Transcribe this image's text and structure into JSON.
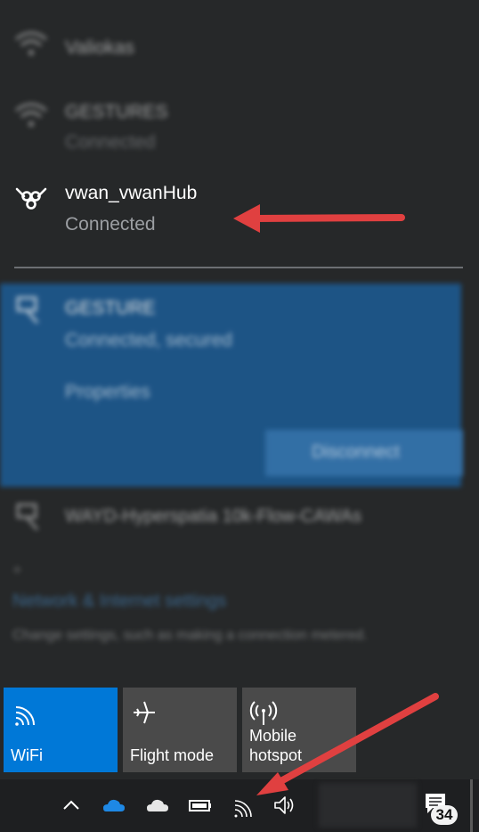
{
  "flyout": {
    "networks_above": [
      {
        "name": "Valiokas",
        "icon": "wifi-icon"
      },
      {
        "name": "GESTURES",
        "status": "Connected",
        "icon": "wifi-icon"
      }
    ],
    "vpn": {
      "name": "vwan_vwanHub",
      "status": "Connected",
      "icon": "vpn-icon"
    },
    "selected_network": {
      "name": "GESTURE",
      "status": "Connected, secured",
      "properties_label": "Properties",
      "disconnect_label": "Disconnect",
      "icon": "ethernet-icon"
    },
    "other_network": {
      "name": "WAYD-Hyperspatia 10k-Flow-CAWAs",
      "icon": "ethernet-icon"
    },
    "settings": {
      "link": "Network & Internet settings",
      "description": "Change settings, such as making a connection metered."
    }
  },
  "quick_actions": [
    {
      "label": "WiFi",
      "icon": "wifi-icon",
      "active": true
    },
    {
      "label": "Flight mode",
      "icon": "airplane-icon",
      "active": false
    },
    {
      "label": "Mobile hotspot",
      "icon": "hotspot-icon",
      "active": false
    }
  ],
  "taskbar": {
    "notification_count": "34",
    "icons": [
      "chevron-up-icon",
      "onedrive-icon",
      "cloud-icon",
      "battery-icon",
      "wifi-icon",
      "volume-icon",
      "notification-icon"
    ]
  },
  "colors": {
    "accent": "#0078d7",
    "tile_inactive": "#4a4a4a",
    "flyout_bg": "#262829",
    "annotation_arrow": "#e04040"
  }
}
